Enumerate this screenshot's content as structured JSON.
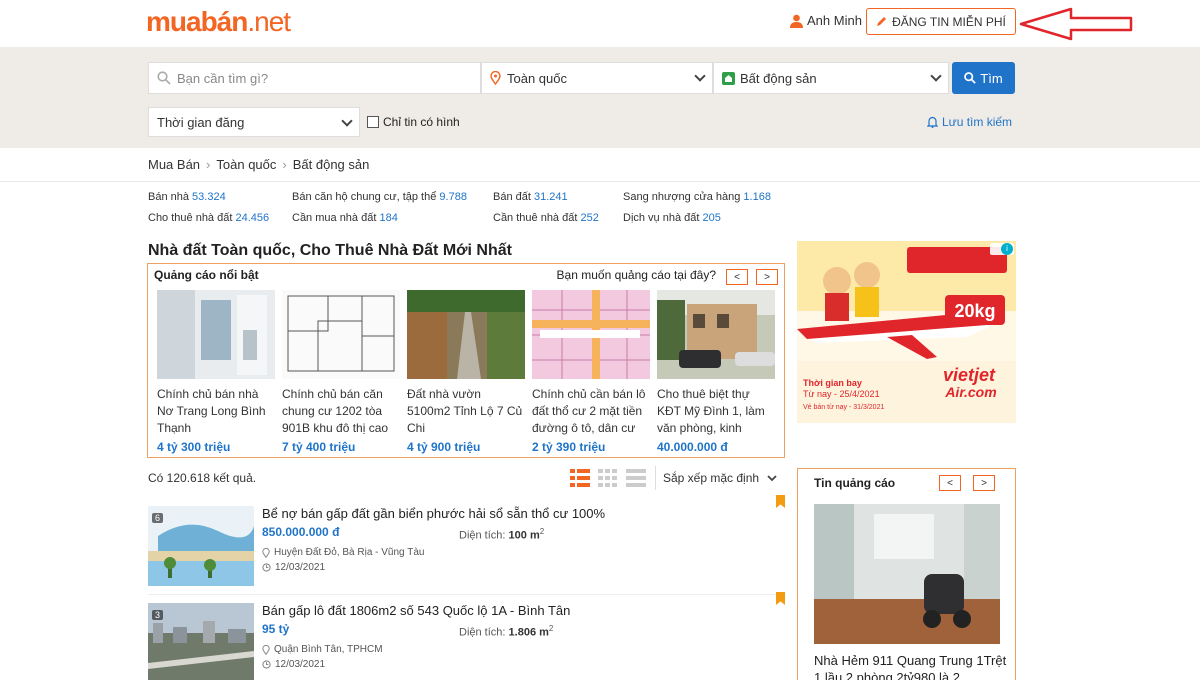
{
  "header": {
    "logo_main": "muabán",
    "logo_tld": ".net",
    "user_name": "Anh Minh",
    "post_button": "ĐĂNG TIN MIỄN PHÍ"
  },
  "search": {
    "keyword_placeholder": "Bạn cần tìm gì?",
    "location": "Toàn quốc",
    "category": "Bất động sản",
    "search_button": "Tìm",
    "time_filter": "Thời gian đăng",
    "photo_only_label": "Chỉ tin có hình",
    "save_search": "Lưu tìm kiếm"
  },
  "breadcrumb": [
    "Mua Bán",
    "Toàn quốc",
    "Bất động sản"
  ],
  "categories": [
    {
      "label": "Bán nhà",
      "count": "53.324"
    },
    {
      "label": "Bán căn hộ chung cư, tập thể",
      "count": "9.788"
    },
    {
      "label": "Bán đất",
      "count": "31.241"
    },
    {
      "label": "Sang nhượng cửa hàng",
      "count": "1.168"
    },
    {
      "label": "Cho thuê nhà đất",
      "count": "24.456"
    },
    {
      "label": "Cần mua nhà đất",
      "count": "184"
    },
    {
      "label": "Cần thuê nhà đất",
      "count": "252"
    },
    {
      "label": "Dịch vụ nhà đất",
      "count": "205"
    }
  ],
  "page_title": "Nhà đất Toàn quốc, Cho Thuê Nhà Đất Mới Nhất",
  "featured": {
    "heading": "Quảng cáo nổi bật",
    "ask": "Bạn muốn quảng cáo tại đây?",
    "prev": "<",
    "next": ">",
    "items": [
      {
        "title": "Chính chủ bán nhà Nơ Trang Long Bình Thạnh",
        "price": "4 tỷ 300 triệu"
      },
      {
        "title": "Chính chủ bán căn chung cư 1202 tòa 901B khu đô thị cao",
        "price": "7 tỷ 400 triệu"
      },
      {
        "title": "Đất nhà vườn 5100m2 Tỉnh Lộ 7 Củ Chi",
        "price": "4 tỷ 900 triệu"
      },
      {
        "title": "Chính chủ cần bán lô đất thổ cư 2 mặt tiền đường ô tô, dân cư",
        "price": "2 tỷ 390 triệu"
      },
      {
        "title": "Cho thuê biệt thự KĐT Mỹ Đình 1, làm văn phòng, kinh",
        "price": "40.000.000 đ"
      }
    ]
  },
  "results": {
    "count_text": "Có 120.618 kết quả.",
    "sort_label": "Sắp xếp mặc định"
  },
  "listings": [
    {
      "title": "Bể nợ bán gấp đất gần biển phước hải sổ sẵn thổ cư 100%",
      "price": "850.000.000 đ",
      "area_label": "Diện tích:",
      "area_value": "100 m",
      "location": "Huyện Đất Đỏ, Bà Rịa - Vũng Tàu",
      "date": "12/03/2021",
      "photos": "6"
    },
    {
      "title": "Bán gấp lô đất 1806m2 số 543 Quốc lộ 1A - Bình Tân",
      "price": "95 tỷ",
      "area_label": "Diện tích:",
      "area_value": "1.806 m",
      "location": "Quận Bình Tân, TPHCM",
      "date": "12/03/2021",
      "photos": "3"
    }
  ],
  "ad_banner": {
    "line1": "20kg",
    "brand": "vietjet",
    "brand2": "Air.com",
    "promo1": "Thời gian bay",
    "promo2": "Từ nay - 25/4/2021",
    "promo3": "Vé bán từ nay - 31/3/2021"
  },
  "sponsored": {
    "heading": "Tin quảng cáo",
    "prev": "<",
    "next": ">",
    "title": "Nhà Hẻm 911 Quang Trung 1Trệt 1 lầu 2 phòng 2tỷ980 là 2"
  },
  "colors": {
    "accent": "#f26522",
    "link": "#1f74c9",
    "band": "#efebe7"
  }
}
